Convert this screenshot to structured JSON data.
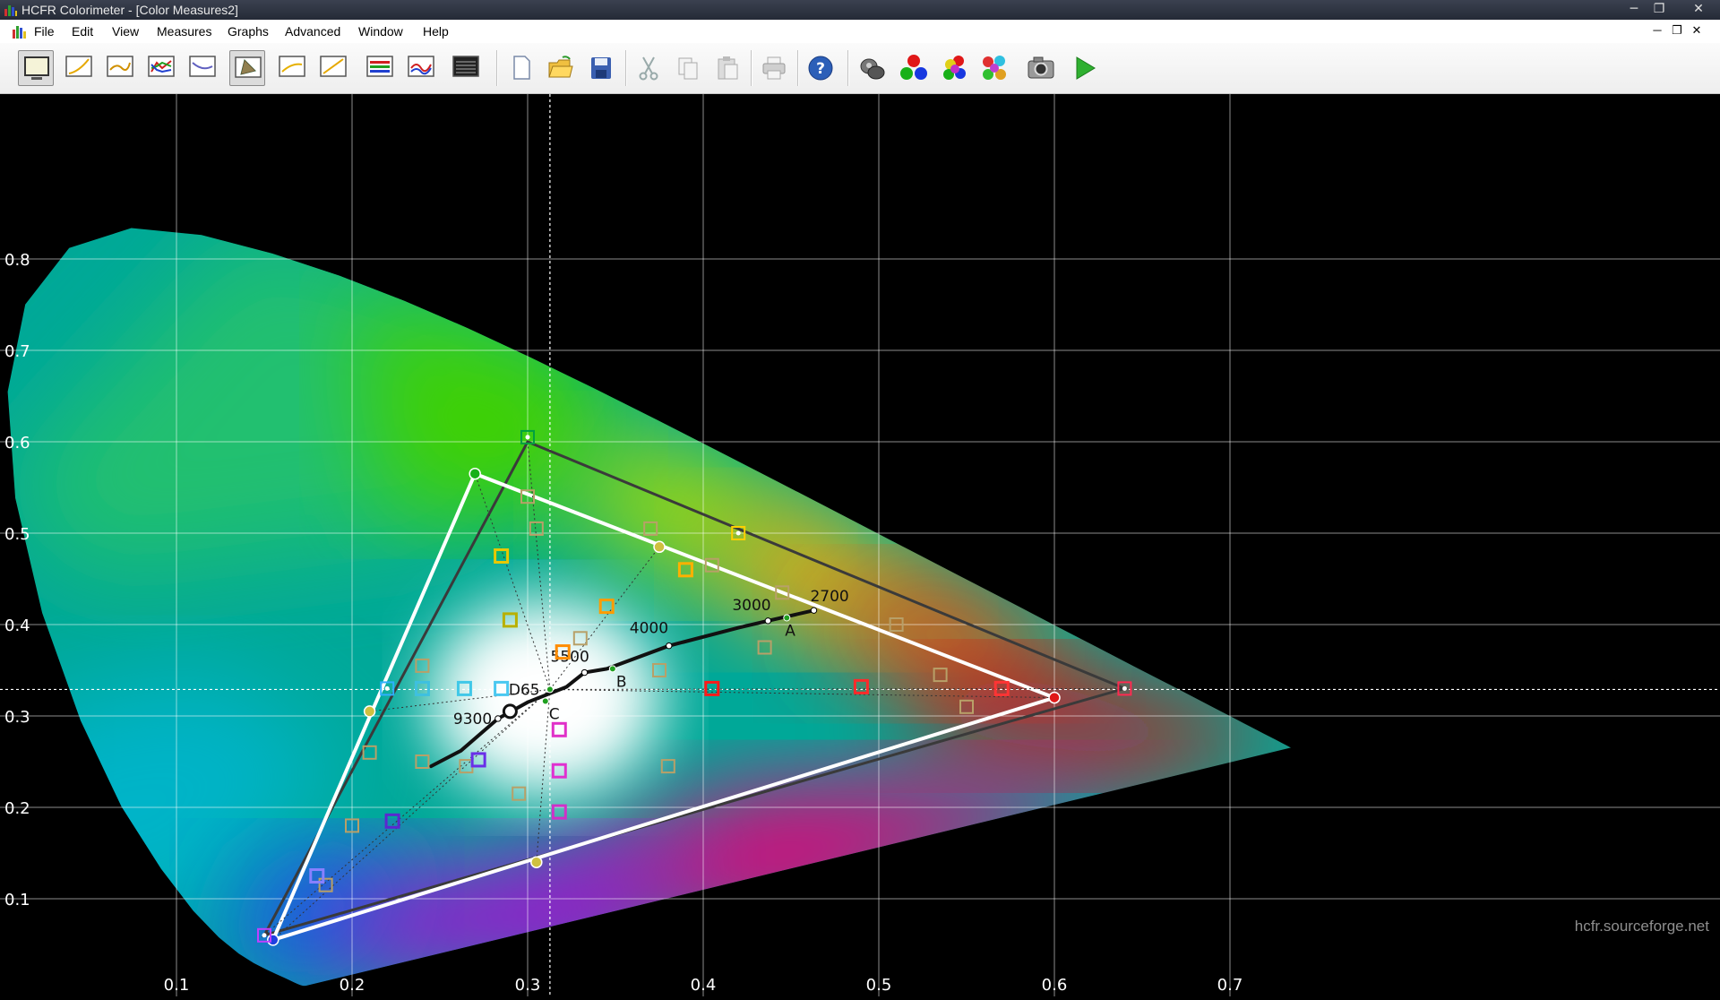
{
  "window": {
    "title": "HCFR Colorimeter - [Color Measures2]",
    "app_icon": "bar-chart-icon",
    "controls": [
      "minimize-icon",
      "restore-icon",
      "close-icon"
    ]
  },
  "menu": {
    "items": [
      "File",
      "Edit",
      "View",
      "Measures",
      "Graphs",
      "Advanced",
      "Window",
      "Help"
    ],
    "mnemonics": [
      "F",
      "E",
      "V",
      "M",
      "G",
      "A",
      "W",
      "H"
    ]
  },
  "toolbar": {
    "icons": [
      "monitor-icon",
      "gamma-graph-icon",
      "luminance-graph-icon",
      "rgb-levels-icon",
      "color-temp-icon",
      "cie-diagram-icon",
      "delta-e-icon",
      "saturation-icon",
      "saturation-shift-icon",
      "color-checker-icon",
      "measures-grid-icon",
      "new-file-icon",
      "open-folder-icon",
      "save-icon",
      "cut-icon",
      "copy-icon",
      "paste-icon",
      "print-icon",
      "help-icon",
      "sensor-icon",
      "rgb-primaries-icon",
      "secondary-colors-icon",
      "color-grid-icon",
      "camera-icon",
      "play-icon"
    ],
    "pressed": [
      "monitor-icon",
      "cie-diagram-icon"
    ]
  },
  "chart_data": {
    "type": "scatter",
    "title": "",
    "xlabel": "",
    "ylabel": "",
    "xlim": [
      0.0,
      0.8
    ],
    "ylim": [
      0.0,
      0.9
    ],
    "x_ticks": [
      "0.1",
      "0.2",
      "0.3",
      "0.4",
      "0.5",
      "0.6",
      "0.7"
    ],
    "y_ticks": [
      "0.1",
      "0.2",
      "0.3",
      "0.4",
      "0.5",
      "0.6",
      "0.7",
      "0.8"
    ],
    "grid": true,
    "crosshair": {
      "x": 0.3127,
      "y": 0.329
    },
    "spectral_locus": [
      [
        0.1741,
        0.005
      ],
      [
        0.1738,
        0.0049
      ],
      [
        0.1736,
        0.0049
      ],
      [
        0.1733,
        0.0048
      ],
      [
        0.173,
        0.0048
      ],
      [
        0.1726,
        0.0048
      ],
      [
        0.1721,
        0.0048
      ],
      [
        0.1714,
        0.0051
      ],
      [
        0.1703,
        0.0058
      ],
      [
        0.1689,
        0.0069
      ],
      [
        0.1669,
        0.0086
      ],
      [
        0.1644,
        0.0109
      ],
      [
        0.1611,
        0.0138
      ],
      [
        0.1566,
        0.0177
      ],
      [
        0.151,
        0.0227
      ],
      [
        0.144,
        0.0297
      ],
      [
        0.1355,
        0.0399
      ],
      [
        0.1241,
        0.0578
      ],
      [
        0.1096,
        0.0868
      ],
      [
        0.0913,
        0.1327
      ],
      [
        0.0687,
        0.2007
      ],
      [
        0.0454,
        0.295
      ],
      [
        0.0235,
        0.4127
      ],
      [
        0.0082,
        0.5384
      ],
      [
        0.0039,
        0.6548
      ],
      [
        0.0139,
        0.7502
      ],
      [
        0.0389,
        0.812
      ],
      [
        0.0743,
        0.8338
      ],
      [
        0.1142,
        0.8262
      ],
      [
        0.1547,
        0.8059
      ],
      [
        0.1929,
        0.7816
      ],
      [
        0.2296,
        0.7543
      ],
      [
        0.2658,
        0.7243
      ],
      [
        0.3016,
        0.6923
      ],
      [
        0.3373,
        0.6589
      ],
      [
        0.3731,
        0.6245
      ],
      [
        0.4087,
        0.5896
      ],
      [
        0.4441,
        0.5547
      ],
      [
        0.4788,
        0.5202
      ],
      [
        0.5125,
        0.4866
      ],
      [
        0.5448,
        0.4544
      ],
      [
        0.5752,
        0.4242
      ],
      [
        0.6029,
        0.3965
      ],
      [
        0.627,
        0.3725
      ],
      [
        0.6482,
        0.3514
      ],
      [
        0.6658,
        0.334
      ],
      [
        0.6801,
        0.3197
      ],
      [
        0.6915,
        0.3083
      ],
      [
        0.7006,
        0.2993
      ],
      [
        0.7079,
        0.292
      ],
      [
        0.714,
        0.2859
      ],
      [
        0.719,
        0.2809
      ],
      [
        0.723,
        0.277
      ],
      [
        0.726,
        0.274
      ],
      [
        0.7283,
        0.2717
      ],
      [
        0.73,
        0.27
      ],
      [
        0.7311,
        0.2689
      ],
      [
        0.732,
        0.268
      ],
      [
        0.7327,
        0.2673
      ],
      [
        0.7334,
        0.2666
      ],
      [
        0.734,
        0.266
      ],
      [
        0.7344,
        0.2656
      ],
      [
        0.7346,
        0.2654
      ],
      [
        0.7347,
        0.2653
      ]
    ],
    "reference_gamut": {
      "red": [
        0.64,
        0.33
      ],
      "green": [
        0.3,
        0.6
      ],
      "blue": [
        0.15,
        0.06
      ]
    },
    "measured_gamut": {
      "red": [
        0.6,
        0.32
      ],
      "green": [
        0.27,
        0.565
      ],
      "blue": [
        0.155,
        0.055
      ]
    },
    "measured_secondaries": {
      "yellow": [
        0.375,
        0.485
      ],
      "cyan": [
        0.21,
        0.305
      ],
      "magenta": [
        0.305,
        0.14
      ]
    },
    "planckian_locus": [
      [
        0.245,
        0.245
      ],
      [
        0.262,
        0.262
      ],
      [
        0.2831,
        0.2971
      ],
      [
        0.3,
        0.315
      ],
      [
        0.3221,
        0.3318
      ],
      [
        0.3324,
        0.3475
      ],
      [
        0.3451,
        0.3516
      ],
      [
        0.3805,
        0.3768
      ],
      [
        0.42,
        0.3965
      ],
      [
        0.4369,
        0.4041
      ],
      [
        0.463,
        0.4155
      ]
    ],
    "cct_labels": [
      {
        "label": "9300",
        "x": 0.2831,
        "y": 0.2971,
        "offset": [
          -50,
          6
        ]
      },
      {
        "label": "5500",
        "x": 0.3324,
        "y": 0.3475,
        "offset": [
          -38,
          -12
        ]
      },
      {
        "label": "4000",
        "x": 0.3805,
        "y": 0.3768,
        "offset": [
          -44,
          -14
        ]
      },
      {
        "label": "3000",
        "x": 0.4369,
        "y": 0.4041,
        "offset": [
          -40,
          -12
        ]
      },
      {
        "label": "2700",
        "x": 0.463,
        "y": 0.4155,
        "offset": [
          -4,
          -10
        ]
      }
    ],
    "illuminants": [
      {
        "label": "D65",
        "x": 0.3127,
        "y": 0.329,
        "offset": [
          -46,
          6
        ]
      },
      {
        "label": "A",
        "x": 0.4476,
        "y": 0.4074,
        "offset": [
          -2,
          20
        ]
      },
      {
        "label": "B",
        "x": 0.3484,
        "y": 0.3516,
        "offset": [
          4,
          20
        ]
      },
      {
        "label": "C",
        "x": 0.3101,
        "y": 0.3162,
        "offset": [
          4,
          20
        ]
      }
    ],
    "saturation_reference_points": [
      [
        0.3,
        0.54
      ],
      [
        0.305,
        0.505
      ],
      [
        0.37,
        0.505
      ],
      [
        0.405,
        0.465
      ],
      [
        0.445,
        0.435
      ],
      [
        0.435,
        0.375
      ],
      [
        0.51,
        0.4
      ],
      [
        0.535,
        0.345
      ],
      [
        0.55,
        0.31
      ],
      [
        0.24,
        0.355
      ],
      [
        0.24,
        0.25
      ],
      [
        0.265,
        0.245
      ],
      [
        0.21,
        0.26
      ],
      [
        0.2,
        0.18
      ],
      [
        0.185,
        0.115
      ],
      [
        0.33,
        0.385
      ],
      [
        0.375,
        0.35
      ],
      [
        0.295,
        0.215
      ],
      [
        0.38,
        0.245
      ]
    ],
    "saturation_measured_points": [
      {
        "c": "#e8c800",
        "x": 0.285,
        "y": 0.475
      },
      {
        "c": "#b8b000",
        "x": 0.29,
        "y": 0.405
      },
      {
        "c": "#ff9c00",
        "x": 0.345,
        "y": 0.42
      },
      {
        "c": "#ffb000",
        "x": 0.39,
        "y": 0.46
      },
      {
        "c": "#ff8c00",
        "x": 0.32,
        "y": 0.37
      },
      {
        "c": "#3ec0e0",
        "x": 0.24,
        "y": 0.33
      },
      {
        "c": "#40c8e8",
        "x": 0.264,
        "y": 0.33
      },
      {
        "c": "#4ac8f0",
        "x": 0.285,
        "y": 0.33
      },
      {
        "c": "#ff1a1a",
        "x": 0.405,
        "y": 0.33
      },
      {
        "c": "#ff2a2a",
        "x": 0.49,
        "y": 0.332
      },
      {
        "c": "#ff3434",
        "x": 0.57,
        "y": 0.33
      },
      {
        "c": "#6a2ee8",
        "x": 0.272,
        "y": 0.252
      },
      {
        "c": "#5a28d0",
        "x": 0.223,
        "y": 0.185
      },
      {
        "c": "#8880ff",
        "x": 0.18,
        "y": 0.125
      },
      {
        "c": "#e030c8",
        "x": 0.318,
        "y": 0.285
      },
      {
        "c": "#e030d0",
        "x": 0.318,
        "y": 0.24
      },
      {
        "c": "#d030c8",
        "x": 0.318,
        "y": 0.195
      }
    ],
    "extra_markers": [
      {
        "c": "#00a040",
        "x": 0.3,
        "y": 0.605
      },
      {
        "c": "#ffcf00",
        "x": 0.42,
        "y": 0.5
      },
      {
        "c": "#ff2a50",
        "x": 0.64,
        "y": 0.33
      },
      {
        "c": "#c040ff",
        "x": 0.15,
        "y": 0.06
      },
      {
        "c": "#2fb0ff",
        "x": 0.22,
        "y": 0.33
      }
    ],
    "watermark": "hcfr.sourceforge.net"
  }
}
